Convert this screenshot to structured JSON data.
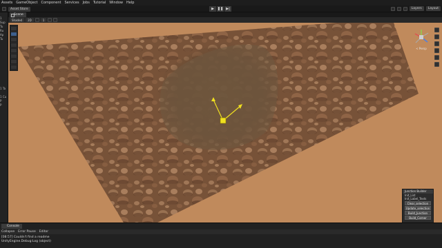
{
  "menu": [
    "Assets",
    "GameObject",
    "Component",
    "Services",
    "Jobs",
    "Tutorial",
    "Window",
    "Help"
  ],
  "toolbar": {
    "account": "Asset Store",
    "play_icon": "▶",
    "pause_icon": "❚❚",
    "step_icon": "▶|",
    "layers": "Layers",
    "layout": "Layout"
  },
  "tabs": {
    "scene": "Scene"
  },
  "scene_toolbar": {
    "shading": "Shaded",
    "mode": "2D",
    "gizmos_count": "1"
  },
  "left_strip_rows": [
    "1",
    "Sup",
    "Tu",
    "Ru",
    "Ap",
    "Tu",
    "",
    "",
    "",
    "",
    "",
    "",
    "",
    "1 Ta",
    "",
    "1 Cu",
    "P",
    "P"
  ],
  "gizmo": {
    "label": "< Persp"
  },
  "junction_builder": {
    "title": "Junction Builder",
    "field1": "Init_List",
    "field2": "Init_Label_Texts",
    "buttons": [
      "Clear_selection",
      "Update_selection",
      "Build_Junction",
      "Build_Corner"
    ]
  },
  "console": {
    "tab": "Console",
    "filters": [
      "Collapse",
      "Error Pause",
      "Editor"
    ],
    "lines": [
      "[08:57] Couldn't find a readme",
      "UnityEngine.Debug:Log (object)"
    ]
  },
  "colors": {
    "terrain_bg": "#c08a5c",
    "terrain_dark": "#6e4a30",
    "accent_blue": "#3d5f8c",
    "gizmo_yellow": "#f0e020"
  }
}
